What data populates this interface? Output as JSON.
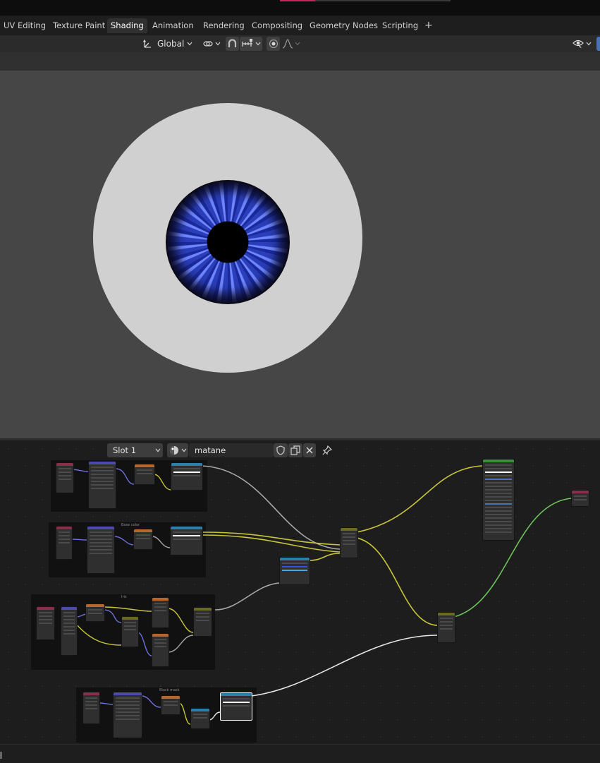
{
  "workspace_tabs": [
    {
      "label": "UV Editing",
      "active": false
    },
    {
      "label": "Texture Paint",
      "active": false
    },
    {
      "label": "Shading",
      "active": true
    },
    {
      "label": "Animation",
      "active": false
    },
    {
      "label": "Rendering",
      "active": false
    },
    {
      "label": "Compositing",
      "active": false
    },
    {
      "label": "Geometry Nodes",
      "active": false
    },
    {
      "label": "Scripting",
      "active": false
    }
  ],
  "add_tab_symbol": "+",
  "toolbar": {
    "transform_orientation": "Global",
    "transform_icon": "orientation-icon",
    "pivot_icon": "link-icon",
    "snap_icon": "magnet-icon",
    "snap_increment_icon": "snap-increment-icon",
    "proportional_icon": "proportional-edit-icon",
    "falloff_icon": "falloff-curve-icon",
    "visibility_icon": "eye-icon"
  },
  "node_header": {
    "slot": "Slot 1",
    "material_name": "matane",
    "material_icon": "material-sphere-icon",
    "fake_user_icon": "shield-icon",
    "duplicate_icon": "duplicate-icon",
    "unlink_icon": "close-icon",
    "pin_icon": "pin-icon"
  },
  "frames": [
    {
      "label": ""
    },
    {
      "label": "Base color"
    },
    {
      "label": "Iris"
    },
    {
      "label": "Black mask"
    }
  ],
  "colors": {
    "accent_active_tab": "#303030",
    "viewport_bg": "#464646",
    "sclera": "#d0d0d0",
    "iris_blue": "#2b3eb9",
    "wire_yellow": "#c8c53a",
    "wire_green": "#6cc35a",
    "wire_gray": "#a0a0a0",
    "wire_white": "#e6e6e6"
  }
}
